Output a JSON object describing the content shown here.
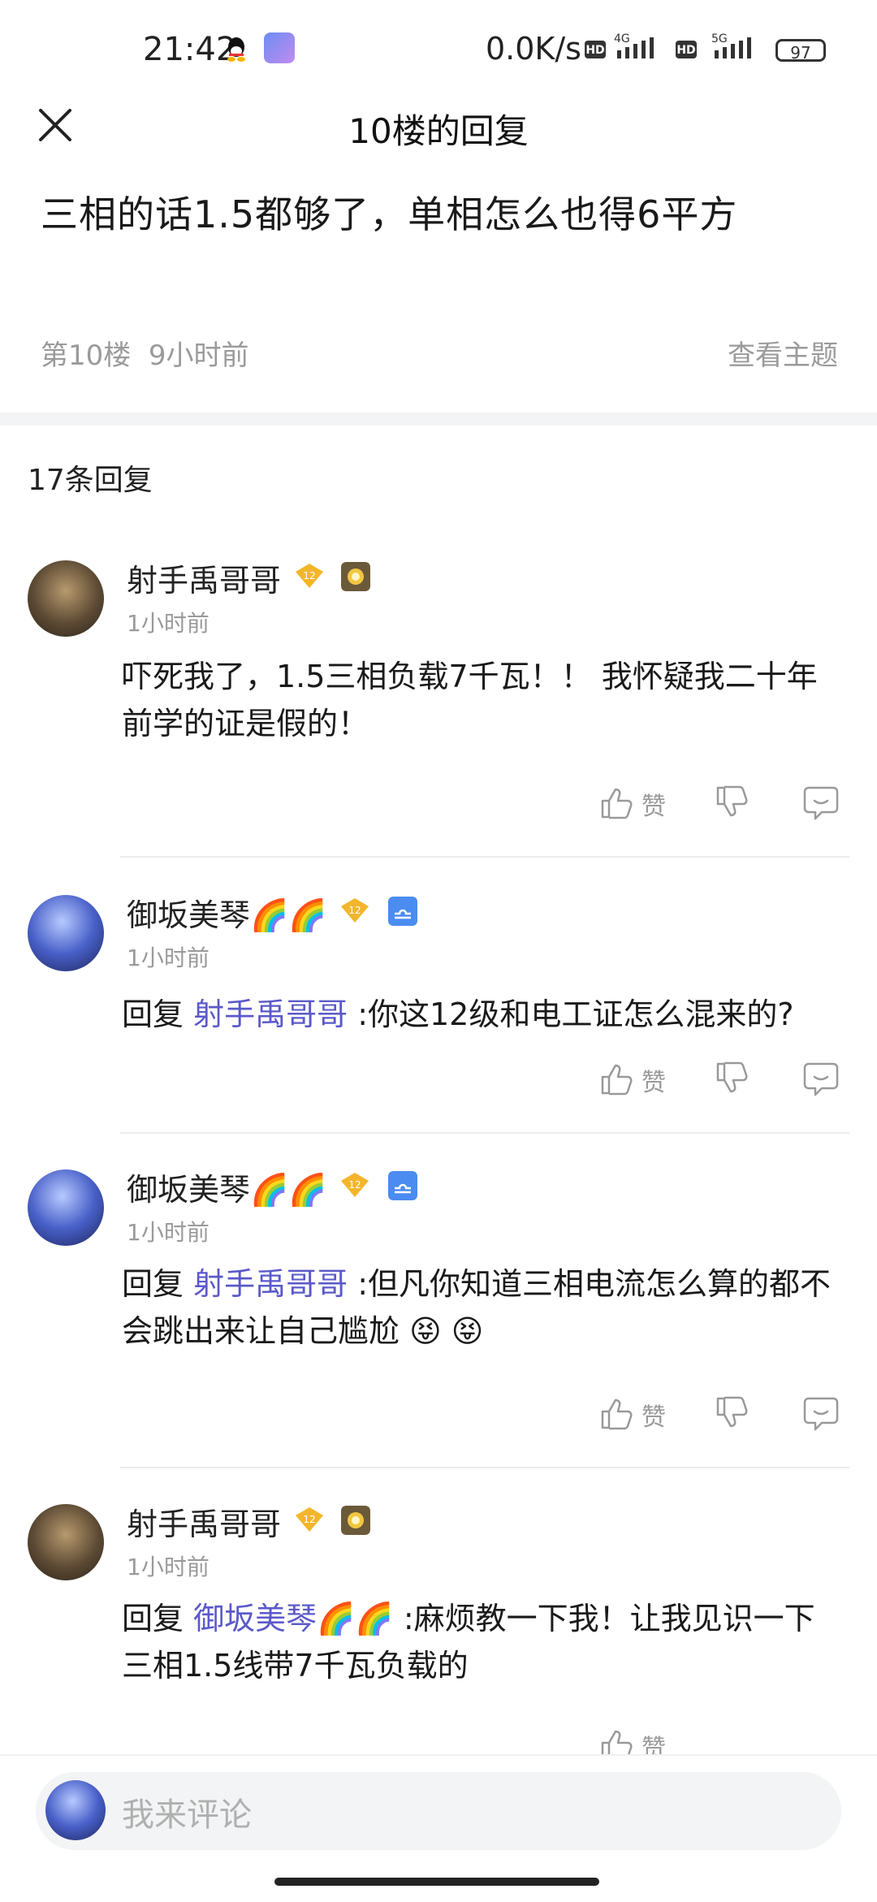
{
  "status_bar": {
    "time": "21:42",
    "net_speed": "0.0K/s",
    "sig1_type": "4G",
    "sig2_type": "5G",
    "hd": "HD",
    "battery": "97"
  },
  "header": {
    "title": "10楼的回复",
    "close_icon": "close-icon"
  },
  "floor": {
    "text": "三相的话1.5都够了，单相怎么也得6平方",
    "label": "第10楼",
    "time": "9小时前",
    "view_topic": "查看主题"
  },
  "reply_count": "17条回复",
  "comments": [
    {
      "user": "射手禹哥哥",
      "level": "12",
      "time": "1小时前",
      "text": "吓死我了，1.5三相负载7千瓦！！ 我怀疑我二十年前学的证是假的！",
      "like": "赞"
    },
    {
      "user": "御坂美琴🌈🌈",
      "level": "12",
      "time": "1小时前",
      "reply_prefix": "回复 ",
      "reply_to": "射手禹哥哥",
      "text": " :你这12级和电工证怎么混来的?",
      "like": "赞"
    },
    {
      "user": "御坂美琴🌈🌈",
      "level": "12",
      "time": "1小时前",
      "reply_prefix": "回复 ",
      "reply_to": "射手禹哥哥",
      "text": " :但凡你知道三相电流怎么算的都不会跳出来让自己尴尬 😝 😝",
      "like": "赞"
    },
    {
      "user": "射手禹哥哥",
      "level": "12",
      "time": "1小时前",
      "reply_prefix": "回复 ",
      "reply_to": "御坂美琴🌈🌈",
      "text": " :麻烦教一下我！让我见识一下三相1.5线带7千瓦负载的",
      "like": "赞"
    }
  ],
  "comment_input": {
    "placeholder": "我来评论"
  },
  "colors": {
    "link": "#5b59c9",
    "muted": "#9a9a9a",
    "badge_gold": "#f3b52c",
    "libra_blue": "#4a8cf0"
  }
}
